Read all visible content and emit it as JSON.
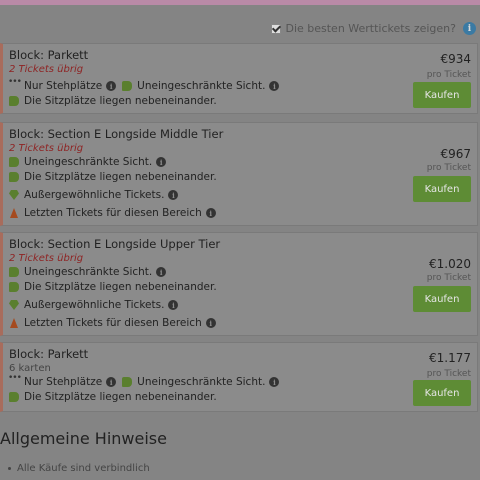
{
  "filter": {
    "label": "Die besten Werttickets zeigen?",
    "checked": true
  },
  "buy_label": "Kaufen",
  "tickets": [
    {
      "title": "Block: Parkett",
      "availability": "2 Tickets übrig",
      "price": "€934",
      "per": "pro Ticket",
      "features": [
        {
          "icon": "dots-icon",
          "text": "Nur Stehplätze",
          "info": true,
          "extra_icon": "thumbs-up-icon",
          "extra_text": "Uneingeschränkte Sicht.",
          "extra_info": true
        },
        {
          "icon": "thumbs-up-icon",
          "text": "Die Sitzplätze liegen nebeneinander.",
          "info": false
        }
      ]
    },
    {
      "title": "Block: Section E Longside Middle Tier",
      "availability": "2 Tickets übrig",
      "price": "€967",
      "per": "pro Ticket",
      "features": [
        {
          "icon": "thumbs-up-icon",
          "text": "Uneingeschränkte Sicht.",
          "info": true
        },
        {
          "icon": "thumbs-up-icon",
          "text": "Die Sitzplätze liegen nebeneinander.",
          "info": false
        },
        {
          "icon": "gem-icon",
          "text": "Außergewöhnliche Tickets.",
          "info": true
        },
        {
          "icon": "cone-icon",
          "text": "Letzten Tickets für diesen Bereich",
          "info": true
        }
      ]
    },
    {
      "title": "Block: Section E Longside Upper Tier",
      "availability": "2 Tickets übrig",
      "price": "€1.020",
      "per": "pro Ticket",
      "features": [
        {
          "icon": "thumbs-up-icon",
          "text": "Uneingeschränkte Sicht.",
          "info": true
        },
        {
          "icon": "thumbs-up-icon",
          "text": "Die Sitzplätze liegen nebeneinander.",
          "info": false
        },
        {
          "icon": "gem-icon",
          "text": "Außergewöhnliche Tickets.",
          "info": true
        },
        {
          "icon": "cone-icon",
          "text": "Letzten Tickets für diesen Bereich",
          "info": true
        }
      ]
    },
    {
      "title": "Block: Parkett",
      "availability": "6 karten",
      "price": "€1.177",
      "per": "pro Ticket",
      "features": [
        {
          "icon": "dots-icon",
          "text": "Nur Stehplätze",
          "info": true,
          "extra_icon": "thumbs-up-icon",
          "extra_text": "Uneingeschränkte Sicht.",
          "extra_info": true
        },
        {
          "icon": "thumbs-up-icon",
          "text": "Die Sitzplätze liegen nebeneinander.",
          "info": false
        }
      ]
    }
  ],
  "notes": {
    "title": "Allgemeine Hinweise",
    "items": [
      "Alle Käufe sind verbindlich"
    ]
  },
  "colors": {
    "accent_green": "#5e8c35",
    "availability_red": "#8e2424",
    "info_blue": "#3b7aa3"
  }
}
